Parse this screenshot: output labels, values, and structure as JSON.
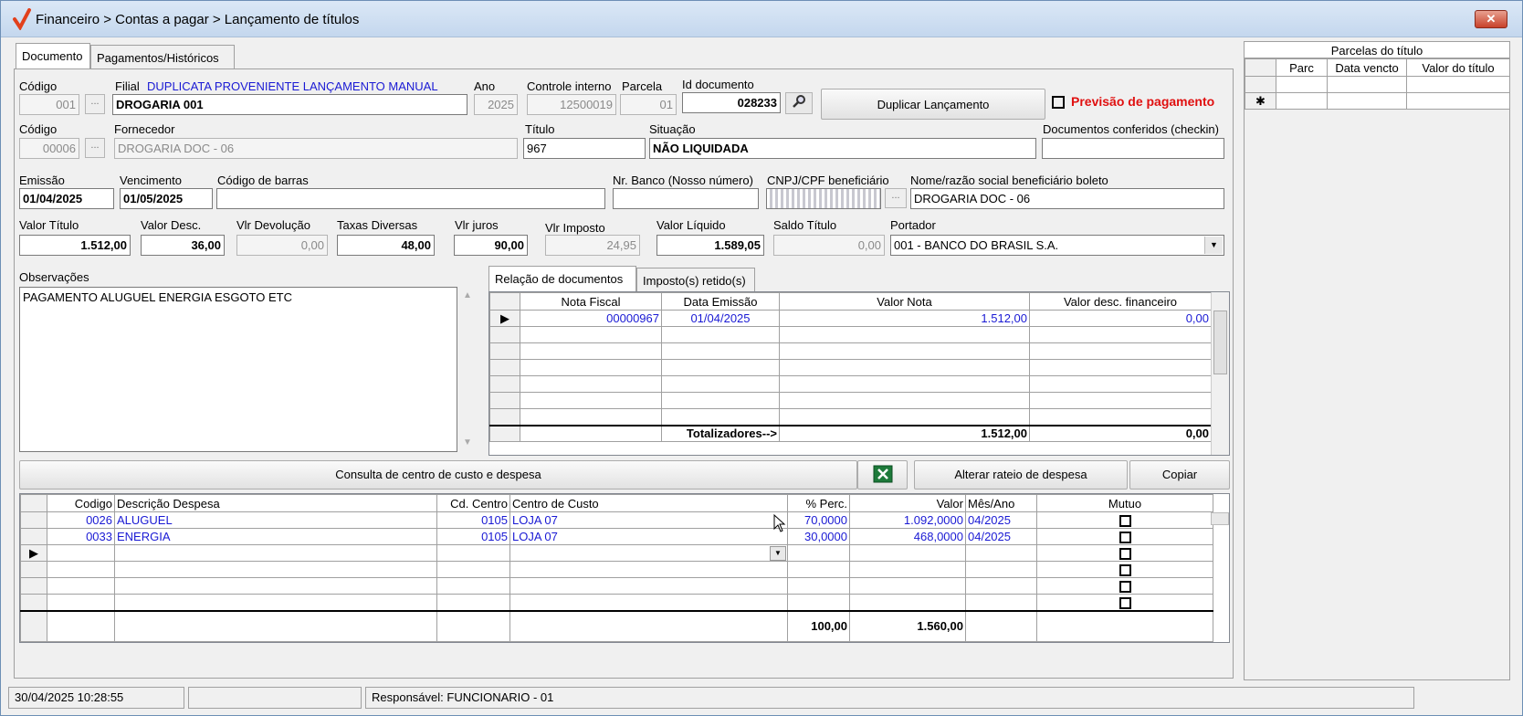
{
  "window": {
    "title": "Financeiro > Contas a pagar > Lançamento de títulos",
    "close_label": "✕"
  },
  "tabs": [
    {
      "label": "Documento"
    },
    {
      "label": "Pagamentos/Históricos"
    }
  ],
  "form": {
    "codigo_label": "Código",
    "codigo": "001",
    "filial_label": "Filial",
    "filial_info": "DUPLICATA PROVENIENTE LANÇAMENTO MANUAL",
    "filial": "DROGARIA 001",
    "ano_label": "Ano",
    "ano": "2025",
    "controle_label": "Controle interno",
    "controle": "12500019",
    "parcela_label": "Parcela",
    "parcela": "01",
    "id_doc_label": "Id documento",
    "id_doc": "028233",
    "duplicar_label": "Duplicar Lançamento",
    "previsao_label": "Previsão de pagamento",
    "codigo2_label": "Código",
    "codigo2": "00006",
    "fornecedor_label": "Fornecedor",
    "fornecedor": "DROGARIA DOC - 06",
    "titulo_label": "Título",
    "titulo": "967",
    "situacao_label": "Situação",
    "situacao": "NÃO LIQUIDADA",
    "docs_conf_label": "Documentos conferidos (checkin)",
    "docs_conf": "",
    "emissao_label": "Emissão",
    "emissao": "01/04/2025",
    "vencimento_label": "Vencimento",
    "vencimento": "01/05/2025",
    "barras_label": "Código de barras",
    "barras": "",
    "nr_banco_label": "Nr. Banco (Nosso número)",
    "nr_banco": "",
    "cnpj_label": "CNPJ/CPF beneficiário",
    "nome_benef_label": "Nome/razão social beneficiário boleto",
    "nome_benef": "DROGARIA DOC - 06",
    "valor_titulo_label": "Valor Título",
    "valor_titulo": "1.512,00",
    "valor_desc_label": "Valor Desc.",
    "valor_desc": "36,00",
    "vlr_devol_label": "Vlr Devolução",
    "vlr_devol": "0,00",
    "taxas_label": "Taxas Diversas",
    "taxas": "48,00",
    "juros_label": "Vlr juros",
    "juros": "90,00",
    "imposto_label": "Vlr Imposto",
    "imposto": "24,95",
    "liquido_label": "Valor Líquido",
    "liquido": "1.589,05",
    "saldo_label": "Saldo Título",
    "saldo": "0,00",
    "portador_label": "Portador",
    "portador": "001 - BANCO DO BRASIL S.A.",
    "obs_label": "Observações",
    "obs": "PAGAMENTO ALUGUEL  ENERGIA  ESGOTO  ETC"
  },
  "doc_tabs": [
    {
      "label": "Relação de documentos"
    },
    {
      "label": "Imposto(s) retido(s)"
    }
  ],
  "docs_grid": {
    "headers": [
      "Nota Fiscal",
      "Data Emissão",
      "Valor Nota",
      "Valor desc. financeiro"
    ],
    "rows": [
      {
        "nf": "00000967",
        "data": "01/04/2025",
        "valor": "1.512,00",
        "desc": "0,00"
      }
    ],
    "total_label": "Totalizadores-->",
    "total_valor": "1.512,00",
    "total_desc": "0,00"
  },
  "buttons": {
    "consulta": "Consulta de centro de custo e despesa",
    "alterar": "Alterar rateio de despesa",
    "copiar": "Copiar"
  },
  "cc_grid": {
    "headers": [
      "Codigo",
      "Descrição Despesa",
      "Cd. Centro",
      "Centro de Custo",
      "% Perc.",
      "Valor",
      "Mês/Ano",
      "Mutuo"
    ],
    "rows": [
      {
        "cod": "0026",
        "desc": "ALUGUEL",
        "cd": "0105",
        "centro": "LOJA 07",
        "perc": "70,0000",
        "valor": "1.092,0000",
        "mes": "04/2025"
      },
      {
        "cod": "0033",
        "desc": "ENERGIA",
        "cd": "0105",
        "centro": "LOJA 07",
        "perc": "30,0000",
        "valor": "468,0000",
        "mes": "04/2025"
      }
    ],
    "total_perc": "100,00",
    "total_valor": "1.560,00"
  },
  "parcelas": {
    "title": "Parcelas do título",
    "headers": [
      "Parc",
      "Data vencto",
      "Valor do título"
    ],
    "new_row": "✱"
  },
  "status": {
    "datetime": "30/04/2025 10:28:55",
    "middle": "",
    "responsavel": "Responsável: FUNCIONARIO - 01"
  }
}
